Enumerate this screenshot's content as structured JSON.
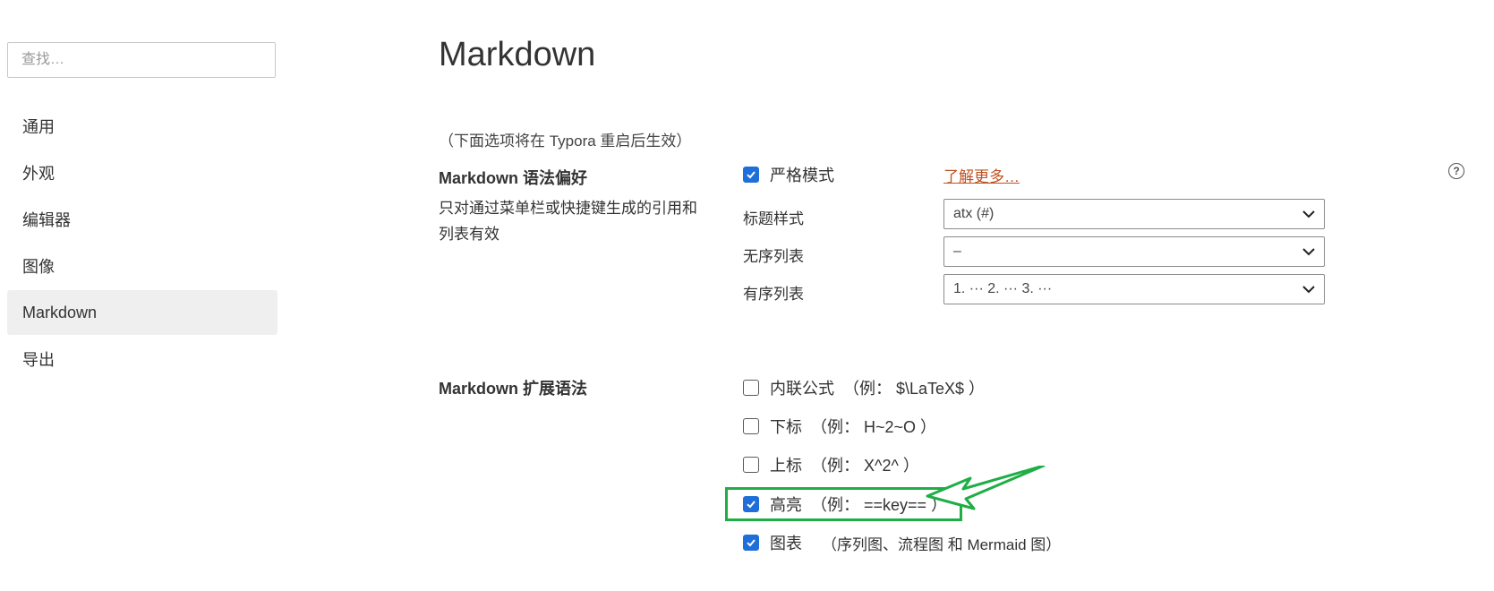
{
  "sidebar": {
    "search_placeholder": "查找…",
    "items": [
      {
        "label": "通用"
      },
      {
        "label": "外观"
      },
      {
        "label": "编辑器"
      },
      {
        "label": "图像"
      },
      {
        "label": "Markdown",
        "active": true
      },
      {
        "label": "导出"
      }
    ]
  },
  "main": {
    "title": "Markdown",
    "restart_note": "（下面选项将在 Typora 重启后生效）",
    "syntax_pref": {
      "title": "Markdown 语法偏好",
      "description": "只对通过菜单栏或快捷键生成的引用和列表有效",
      "strict_mode": {
        "label": "严格模式",
        "checked": true
      },
      "learn_more": "了解更多…",
      "help_icon": "question-circle-icon",
      "heading_style": {
        "label": "标题样式",
        "value": "atx (#)"
      },
      "unordered_list": {
        "label": "无序列表",
        "value": "–"
      },
      "ordered_list": {
        "label": "有序列表",
        "value": "1. ··· 2. ··· 3. ···"
      }
    },
    "extensions": {
      "title": "Markdown 扩展语法",
      "items": [
        {
          "label": "内联公式",
          "example": "（例： $\\LaTeX$ ）",
          "checked": false
        },
        {
          "label": "下标",
          "example": "（例： H~2~O ）",
          "checked": false
        },
        {
          "label": "上标",
          "example": "（例： X^2^ ）",
          "checked": false
        },
        {
          "label": "高亮",
          "example": "（例： ==key== ）",
          "checked": true
        },
        {
          "label": "图表",
          "example": "（序列图、流程图 和 Mermaid 图）",
          "checked": true
        }
      ]
    }
  },
  "colors": {
    "accent": "#1e6fd9",
    "link": "#c0501f",
    "annotation": "#1fae46",
    "active_nav_bg": "#efefef"
  }
}
